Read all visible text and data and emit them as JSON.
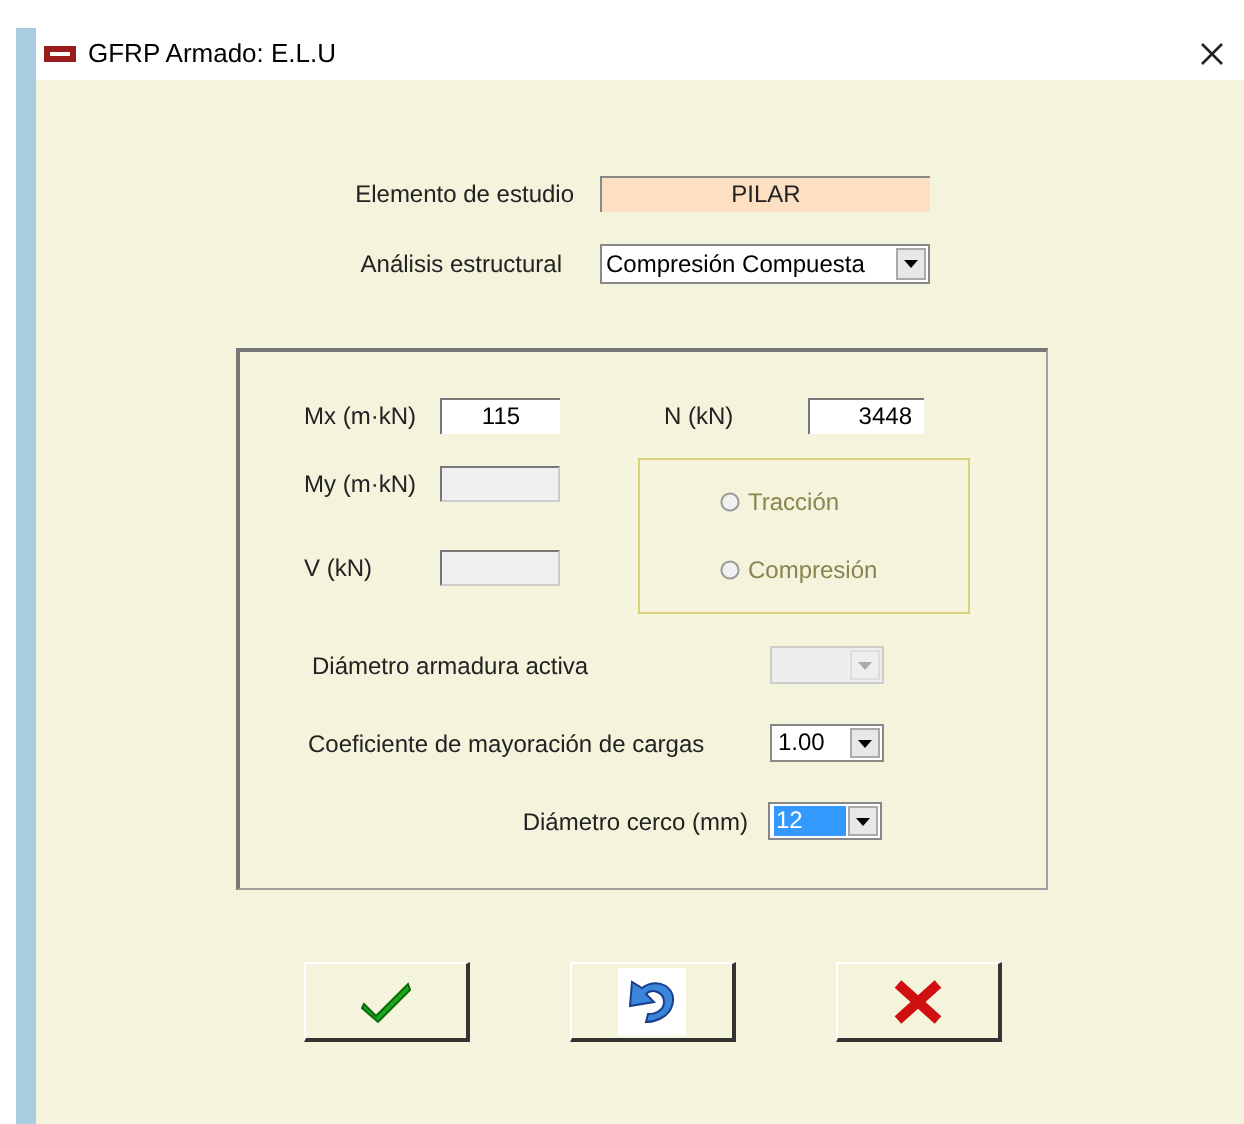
{
  "window": {
    "title": "GFRP Armado: E.L.U"
  },
  "elemento": {
    "label": "Elemento de estudio",
    "value": "PILAR"
  },
  "analisis": {
    "label": "Análisis estructural",
    "value": "Compresión Compuesta"
  },
  "loads": [
    {
      "label": "Mx (m·kN)",
      "value": "115",
      "disabled": false
    },
    {
      "label": "My (m·kN)",
      "disabled": true
    },
    {
      "label": "V (kN)",
      "disabled": true
    }
  ],
  "axial": {
    "label": "N (kN)",
    "value": "3448"
  },
  "axial_type": [
    {
      "label": "Tracción",
      "selected": false,
      "disabled": true
    },
    {
      "label": "Compresión",
      "selected": false,
      "disabled": true
    }
  ],
  "options": [
    {
      "label": "Diámetro armadura activa",
      "disabled": true,
      "highlighted": false
    },
    {
      "label": "Coeficiente de mayoración de cargas",
      "value": "1.00",
      "disabled": false,
      "highlighted": false
    },
    {
      "label": "Diámetro cerco (mm)",
      "value": "12",
      "disabled": false,
      "highlighted": true
    }
  ],
  "buttons": [
    {
      "kind": "accept"
    },
    {
      "kind": "undo"
    },
    {
      "kind": "cancel"
    }
  ]
}
